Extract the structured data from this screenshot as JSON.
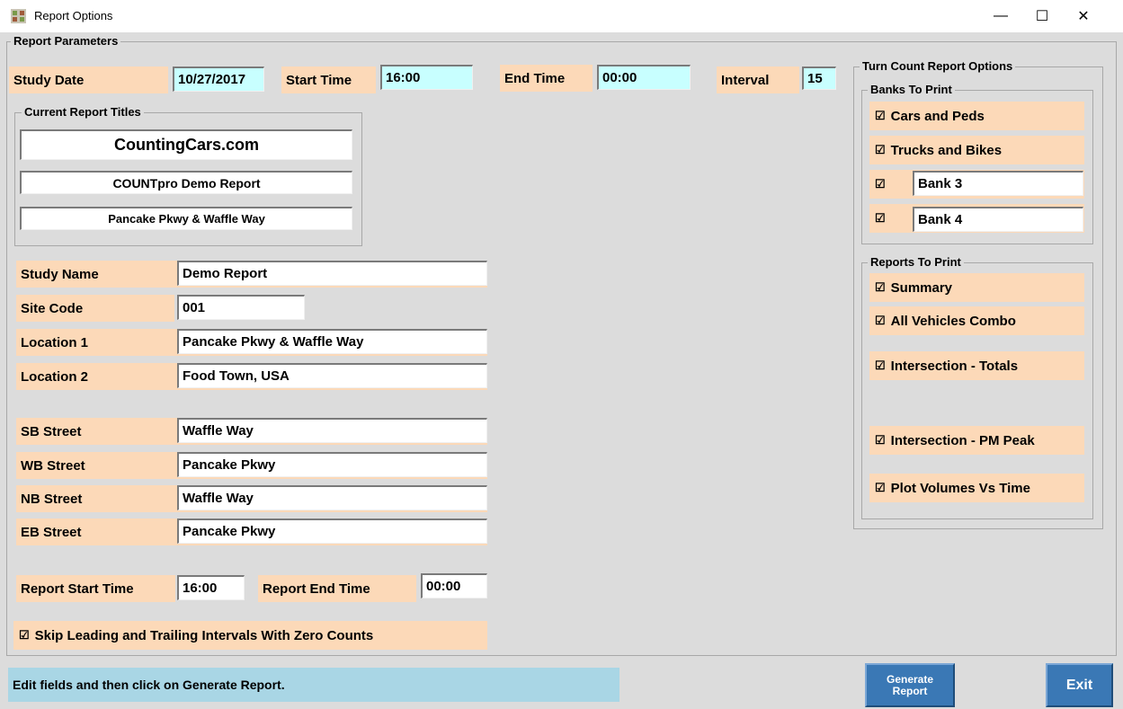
{
  "window": {
    "title": "Report Options",
    "minimize_label": "—",
    "maximize_label": "☐",
    "close_label": "✕"
  },
  "report_parameters": {
    "legend": "Report Parameters",
    "study_date_label": "Study Date",
    "study_date_value": "10/27/2017",
    "start_time_label": "Start Time",
    "start_time_value": "16:00",
    "end_time_label": "End Time",
    "end_time_value": "00:00",
    "interval_label": "Interval",
    "interval_value": "15"
  },
  "titles": {
    "legend": "Current Report Titles",
    "title1": "CountingCars.com",
    "title2": "COUNTpro Demo Report",
    "title3": "Pancake Pkwy & Waffle Way"
  },
  "study": {
    "study_name_label": "Study Name",
    "study_name_value": "Demo Report",
    "site_code_label": "Site Code",
    "site_code_value": "001",
    "location1_label": "Location 1",
    "location1_value": "Pancake Pkwy & Waffle Way",
    "location2_label": "Location 2",
    "location2_value": "Food Town, USA"
  },
  "streets": {
    "sb_label": "SB Street",
    "sb_value": "Waffle Way",
    "wb_label": "WB Street",
    "wb_value": "Pancake Pkwy",
    "nb_label": "NB Street",
    "nb_value": "Waffle Way",
    "eb_label": "EB Street",
    "eb_value": "Pancake Pkwy"
  },
  "report_times": {
    "start_label": "Report Start Time",
    "start_value": "16:00",
    "end_label": "Report End Time",
    "end_value": "00:00"
  },
  "skip_zero": {
    "check": "☑",
    "label": "Skip Leading and Trailing Intervals With Zero Counts"
  },
  "turn_count": {
    "legend": "Turn Count Report Options",
    "banks_legend": "Banks To Print",
    "banks": [
      {
        "check": "☑",
        "label": "Cars and Peds"
      },
      {
        "check": "☑",
        "label": "Trucks and Bikes"
      },
      {
        "check": "☑",
        "value": "Bank 3"
      },
      {
        "check": "☑",
        "value": "Bank 4"
      }
    ],
    "reports_legend": "Reports To Print",
    "reports": [
      {
        "check": "☑",
        "label": "Summary"
      },
      {
        "check": "☑",
        "label": "All Vehicles Combo"
      },
      {
        "check": "☑",
        "label": "Intersection - Totals"
      },
      {
        "check": "☑",
        "label": "Intersection - PM Peak"
      },
      {
        "check": "☑",
        "label": "Plot Volumes Vs Time"
      }
    ]
  },
  "status_text": "Edit fields and then click on Generate Report.",
  "buttons": {
    "generate_line1": "Generate",
    "generate_line2": "Report",
    "exit": "Exit"
  },
  "colors": {
    "label_bg": "#fcd9b8",
    "input_cyan": "#c8ffff",
    "status_bg": "#a9d6e5",
    "button_blue": "#3a78b5"
  }
}
